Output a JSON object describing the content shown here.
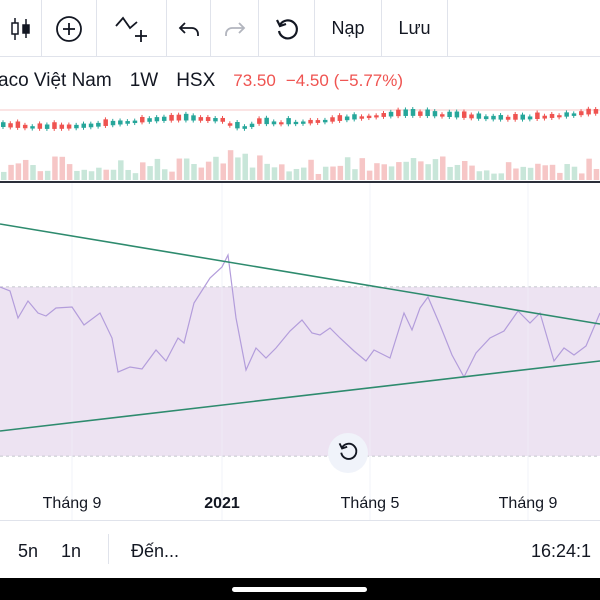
{
  "toolbar": {
    "candles_icon": "candlestick-icon",
    "add_indicator_icon": "plus-circle-icon",
    "indicators_icon": "indicator-wave-plus-icon",
    "undo_icon": "undo-icon",
    "redo_icon": "redo-icon",
    "reload_icon": "rotate-ccw-icon",
    "load_label": "Nạp",
    "save_label": "Lưu"
  },
  "legend": {
    "title": "aco Việt Nam",
    "timeframe": "1W",
    "exchange": "HSX",
    "price": "73.50",
    "change": "−4.50 (−5.77%)",
    "down_color": "#ef5350",
    "up_color": "#26a69a"
  },
  "time_axis": {
    "labels": [
      "Tháng 9",
      "2021",
      "Tháng 5",
      "Tháng 9"
    ]
  },
  "bottom_bar": {
    "range_5y": "5n",
    "range_1y": "1n",
    "goto": "Đến...",
    "clock": "16:24:1"
  },
  "rsi_colors": {
    "band_fill": "#ede3f2",
    "line": "#b39ddb",
    "trendline": "#2e8b6e"
  }
}
